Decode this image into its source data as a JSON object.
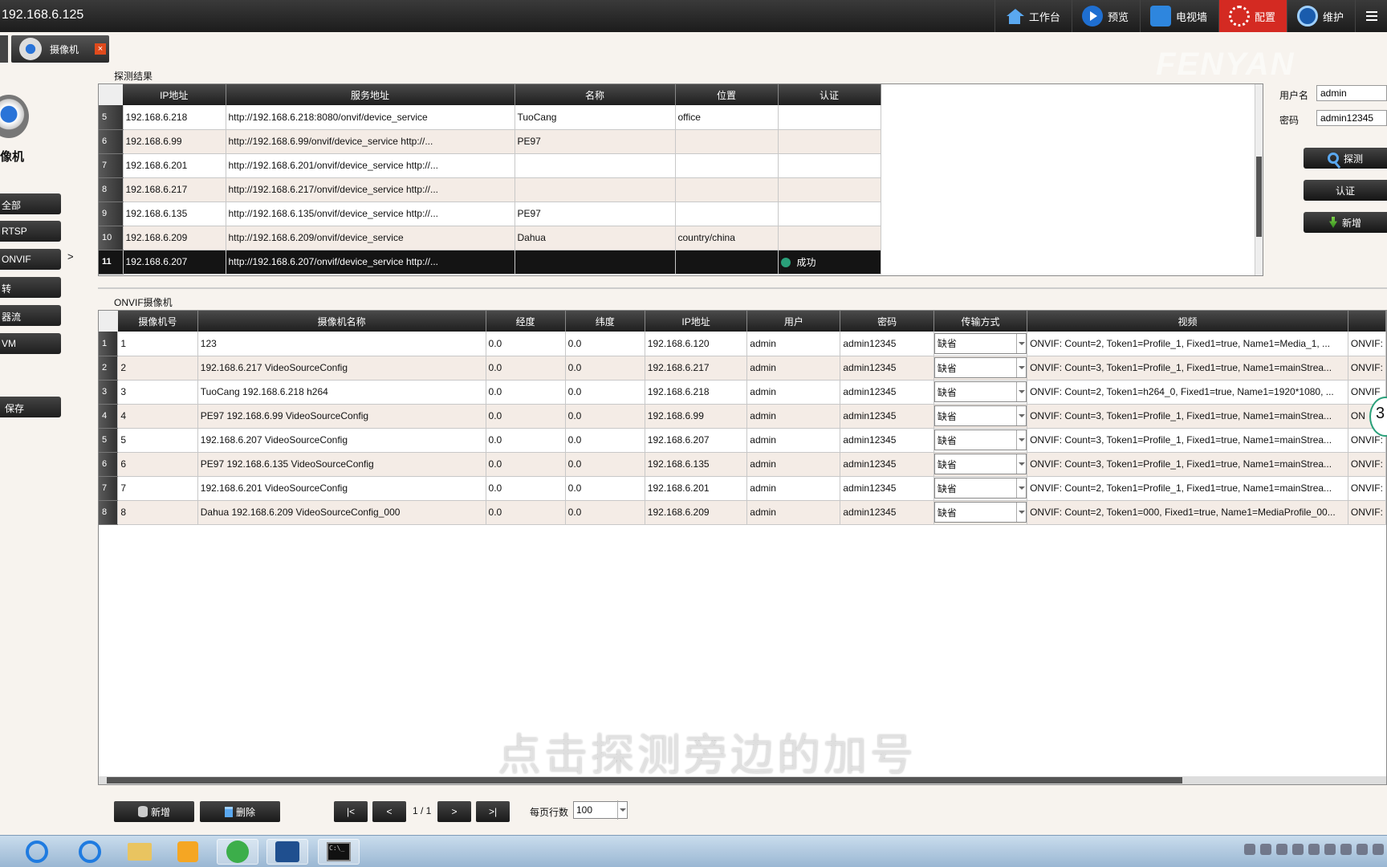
{
  "window": {
    "host": "192.168.6.125"
  },
  "topnav": [
    {
      "label": "工作台",
      "icon": "home-icon"
    },
    {
      "label": "预览",
      "icon": "play-icon"
    },
    {
      "label": "电视墙",
      "icon": "tv-wall-icon"
    },
    {
      "label": "配置",
      "icon": "gear-icon",
      "active": true
    },
    {
      "label": "维护",
      "icon": "maintenance-icon"
    }
  ],
  "tab": {
    "label": "摄像机",
    "close": "×"
  },
  "sidebar": {
    "title": "像机",
    "items": [
      "全部",
      "RTSP",
      "ONVIF",
      "转",
      "器流",
      "VM"
    ],
    "arrow": ">",
    "save": "保存"
  },
  "discovery": {
    "label": "探测结果",
    "columns": [
      "IP地址",
      "服务地址",
      "名称",
      "位置",
      "认证"
    ],
    "rows": [
      {
        "n": "5",
        "ip": "192.168.6.218",
        "svc": "http://192.168.6.218:8080/onvif/device_service",
        "name": "TuoCang",
        "loc": "office",
        "auth": ""
      },
      {
        "n": "6",
        "ip": "192.168.6.99",
        "svc": "http://192.168.6.99/onvif/device_service http://...",
        "name": "PE97",
        "loc": "",
        "auth": ""
      },
      {
        "n": "7",
        "ip": "192.168.6.201",
        "svc": "http://192.168.6.201/onvif/device_service http://...",
        "name": "",
        "loc": "",
        "auth": ""
      },
      {
        "n": "8",
        "ip": "192.168.6.217",
        "svc": "http://192.168.6.217/onvif/device_service http://...",
        "name": "",
        "loc": "",
        "auth": ""
      },
      {
        "n": "9",
        "ip": "192.168.6.135",
        "svc": "http://192.168.6.135/onvif/device_service http://...",
        "name": "PE97",
        "loc": "",
        "auth": ""
      },
      {
        "n": "10",
        "ip": "192.168.6.209",
        "svc": "http://192.168.6.209/onvif/device_service",
        "name": "Dahua",
        "loc": "country/china",
        "auth": ""
      },
      {
        "n": "11",
        "ip": "192.168.6.207",
        "svc": "http://192.168.6.207/onvif/device_service http://...",
        "name": "",
        "loc": "",
        "auth": "成功",
        "selected": true
      }
    ]
  },
  "credentials": {
    "user_label": "用户名",
    "user_value": "admin",
    "pass_label": "密码",
    "pass_value": "admin12345",
    "detect": "探测",
    "auth": "认证",
    "add": "新增"
  },
  "onvif": {
    "label": "ONVIF摄像机",
    "columns": [
      "摄像机号",
      "摄像机名称",
      "经度",
      "纬度",
      "IP地址",
      "用户",
      "密码",
      "传输方式",
      "视频",
      ""
    ],
    "rows": [
      {
        "n": "1",
        "num": "1",
        "name": "123",
        "lng": "0.0",
        "lat": "0.0",
        "ip": "192.168.6.120",
        "user": "admin",
        "pwd": "admin12345",
        "trans": "缺省",
        "video": "ONVIF: Count=2, Token1=Profile_1, Fixed1=true, Name1=Media_1, ...",
        "extra": "ONVIF:"
      },
      {
        "n": "2",
        "num": "2",
        "name": " 192.168.6.217 VideoSourceConfig",
        "lng": "0.0",
        "lat": "0.0",
        "ip": "192.168.6.217",
        "user": "admin",
        "pwd": "admin12345",
        "trans": "缺省",
        "video": "ONVIF: Count=3, Token1=Profile_1, Fixed1=true, Name1=mainStrea...",
        "extra": "ONVIF:"
      },
      {
        "n": "3",
        "num": "3",
        "name": "TuoCang 192.168.6.218 h264",
        "lng": "0.0",
        "lat": "0.0",
        "ip": "192.168.6.218",
        "user": "admin",
        "pwd": "admin12345",
        "trans": "缺省",
        "video": "ONVIF: Count=2, Token1=h264_0, Fixed1=true, Name1=1920*1080, ...",
        "extra": "ONVIF"
      },
      {
        "n": "4",
        "num": "4",
        "name": "PE97 192.168.6.99 VideoSourceConfig",
        "lng": "0.0",
        "lat": "0.0",
        "ip": "192.168.6.99",
        "user": "admin",
        "pwd": "admin12345",
        "trans": "缺省",
        "video": "ONVIF: Count=3, Token1=Profile_1, Fixed1=true, Name1=mainStrea...",
        "extra": "ON"
      },
      {
        "n": "5",
        "num": "5",
        "name": " 192.168.6.207 VideoSourceConfig",
        "lng": "0.0",
        "lat": "0.0",
        "ip": "192.168.6.207",
        "user": "admin",
        "pwd": "admin12345",
        "trans": "缺省",
        "video": "ONVIF: Count=3, Token1=Profile_1, Fixed1=true, Name1=mainStrea...",
        "extra": "ONVIF:"
      },
      {
        "n": "6",
        "num": "6",
        "name": "PE97 192.168.6.135 VideoSourceConfig",
        "lng": "0.0",
        "lat": "0.0",
        "ip": "192.168.6.135",
        "user": "admin",
        "pwd": "admin12345",
        "trans": "缺省",
        "video": "ONVIF: Count=3, Token1=Profile_1, Fixed1=true, Name1=mainStrea...",
        "extra": "ONVIF:"
      },
      {
        "n": "7",
        "num": "7",
        "name": " 192.168.6.201 VideoSourceConfig",
        "lng": "0.0",
        "lat": "0.0",
        "ip": "192.168.6.201",
        "user": "admin",
        "pwd": "admin12345",
        "trans": "缺省",
        "video": "ONVIF: Count=2, Token1=Profile_1, Fixed1=true, Name1=mainStrea...",
        "extra": "ONVIF:"
      },
      {
        "n": "8",
        "num": "8",
        "name": "Dahua 192.168.6.209 VideoSourceConfig_000",
        "lng": "0.0",
        "lat": "0.0",
        "ip": "192.168.6.209",
        "user": "admin",
        "pwd": "admin12345",
        "trans": "缺省",
        "video": "ONVIF: Count=2, Token1=000, Fixed1=true, Name1=MediaProfile_00...",
        "extra": "ONVIF:"
      }
    ]
  },
  "toolbar": {
    "add": "新增",
    "delete": "删除",
    "first": "|<",
    "prev": "<",
    "page": "1 / 1",
    "next": ">",
    "last": ">|",
    "rows_label": "每页行数",
    "rows_value": "100"
  },
  "overlay": {
    "watermark": "FENYAN",
    "subtitle": "点击探测旁边的加号",
    "badge": "3"
  },
  "taskbar": {
    "cmd_text": "C:\\_"
  }
}
